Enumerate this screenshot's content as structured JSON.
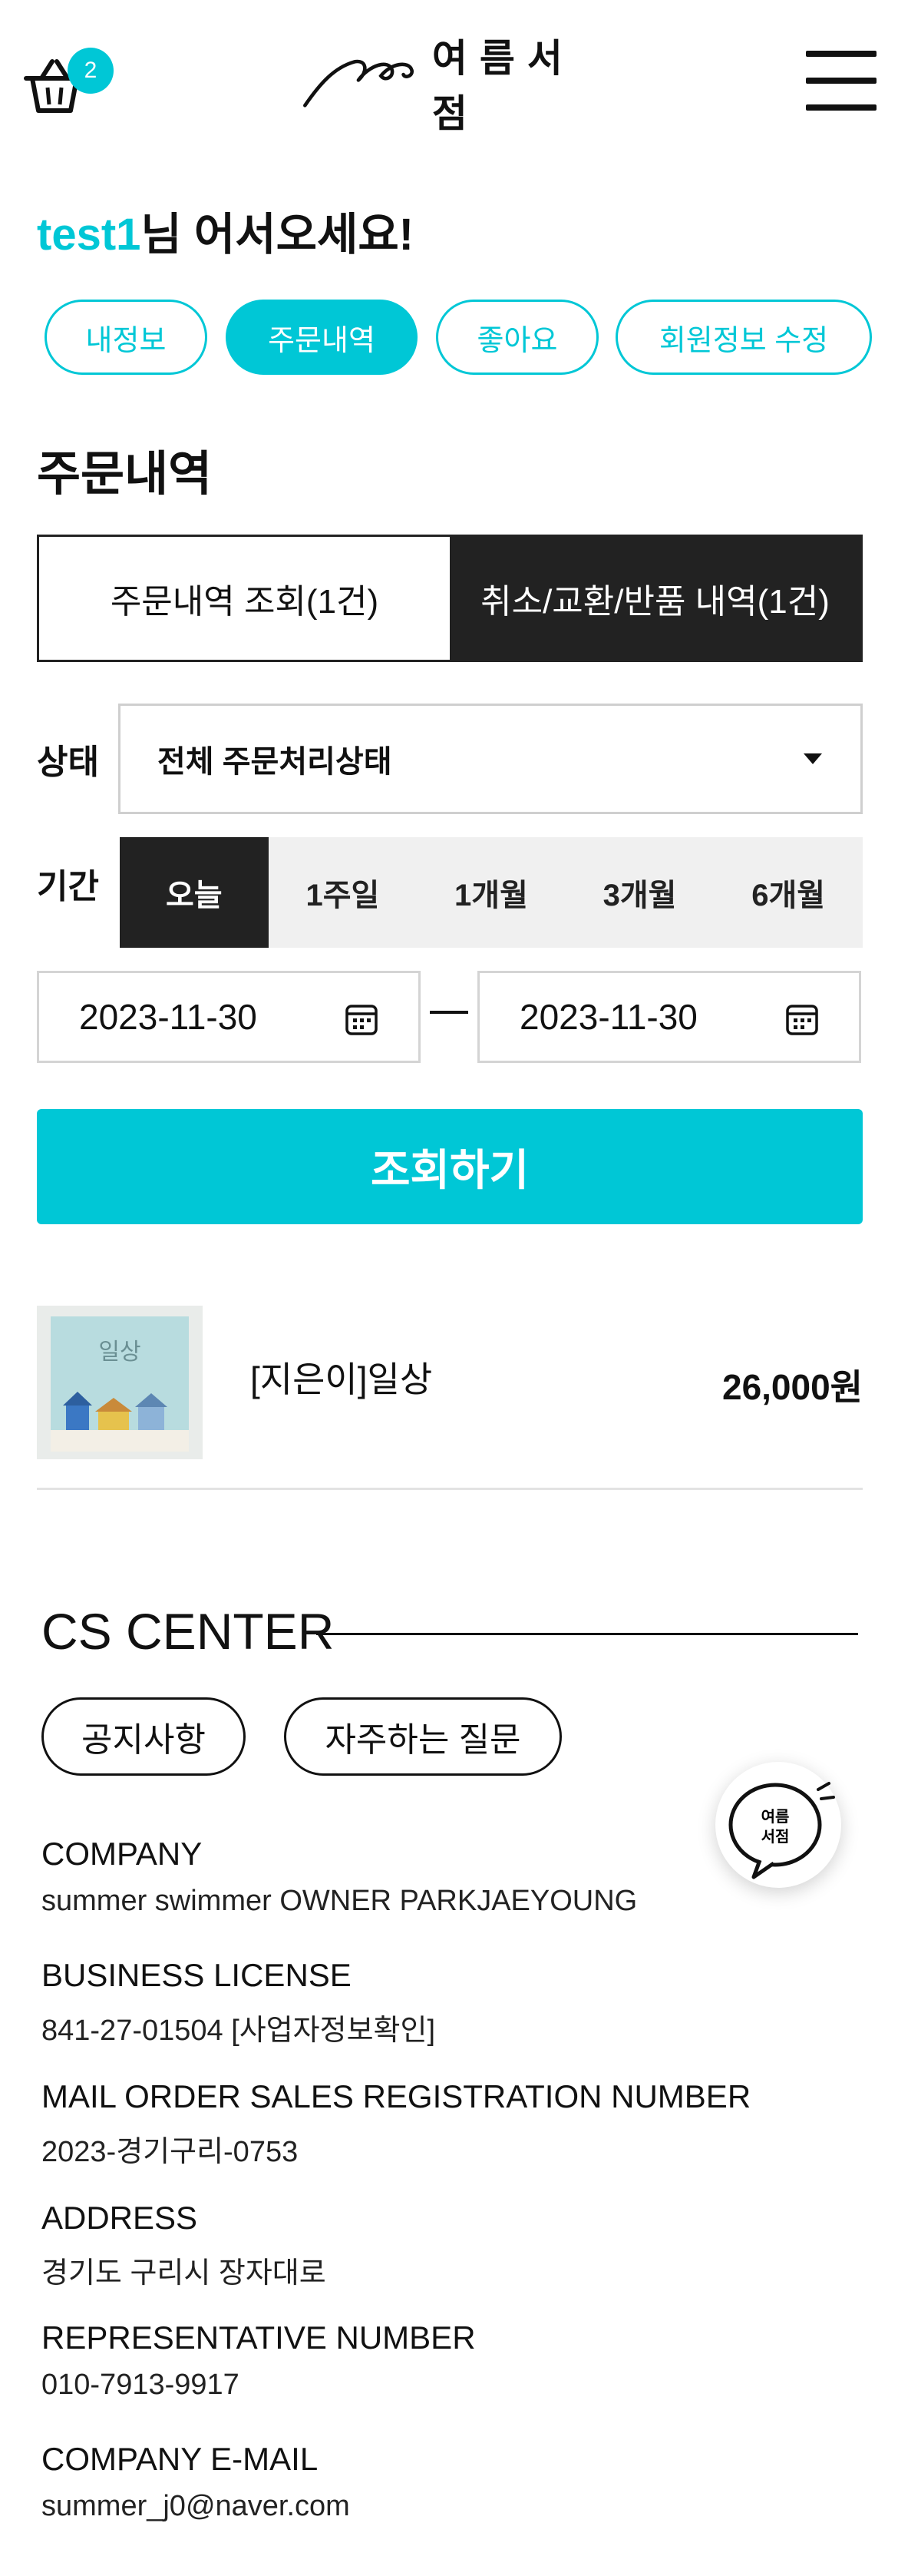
{
  "header": {
    "cart_count": "2",
    "logo_text": "여름서점"
  },
  "greeting": {
    "user": "test1",
    "message": "님 어서오세요!"
  },
  "mypage_tabs": [
    {
      "label": "내정보",
      "active": false
    },
    {
      "label": "주문내역",
      "active": true
    },
    {
      "label": "좋아요",
      "active": false
    },
    {
      "label": "회원정보 수정",
      "active": false
    }
  ],
  "section_title": "주문내역",
  "order_tabs": [
    {
      "label": "주문내역 조회(1건)",
      "active": false
    },
    {
      "label": "취소/교환/반품 내역(1건)",
      "active": true
    }
  ],
  "filters": {
    "status_label": "상태",
    "status_value": "전체 주문처리상태",
    "period_label": "기간",
    "period_options": [
      "오늘",
      "1주일",
      "1개월",
      "3개월",
      "6개월"
    ],
    "period_selected": "오늘",
    "start_date": "2023-11-30",
    "end_date": "2023-11-30",
    "search_button": "조회하기"
  },
  "orders": [
    {
      "title": "[지은이]일상",
      "price": "26,000원",
      "cover_title": "일상"
    }
  ],
  "cs": {
    "title": "CS CENTER",
    "buttons": [
      "공지사항",
      "자주하는 질문"
    ],
    "fab_text": "여름서점",
    "info": [
      {
        "label": "COMPANY",
        "value": "summer swimmer OWNER PARKJAEYOUNG"
      },
      {
        "label": "BUSINESS LICENSE",
        "value": "841-27-01504 [사업자정보확인]"
      },
      {
        "label": "MAIL ORDER SALES REGISTRATION NUMBER",
        "value": "2023-경기구리-0753"
      },
      {
        "label": "ADDRESS",
        "value": "경기도 구리시 장자대로"
      },
      {
        "label": "REPRESENTATIVE NUMBER",
        "value": "010-7913-9917"
      },
      {
        "label": "COMPANY E-MAIL",
        "value": "summer_j0@naver.com"
      }
    ]
  },
  "colors": {
    "accent": "#00c7d6",
    "dark": "#222222"
  }
}
